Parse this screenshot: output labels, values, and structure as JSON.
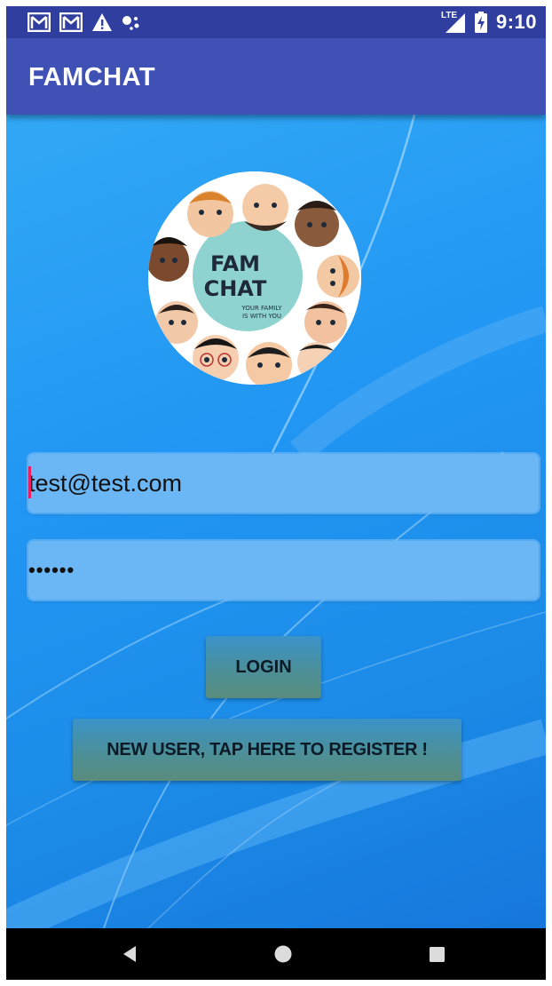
{
  "status_bar": {
    "time": "9:10",
    "network_label": "LTE",
    "left_icons": [
      "gmail-icon",
      "gmail-icon",
      "warning-icon",
      "assistant-dots-icon"
    ],
    "right_icons": [
      "signal-icon",
      "battery-charging-icon"
    ]
  },
  "app_bar": {
    "title": "FAMCHAT",
    "color": "#3f51b5"
  },
  "logo": {
    "line1": "FAM",
    "line2": "CHAT",
    "tagline1": "YOUR FAMILY",
    "tagline2": "IS WITH YOU"
  },
  "form": {
    "email_value": "test@test.com",
    "password_value": "••••••"
  },
  "buttons": {
    "login_label": "LOGIN",
    "register_label": "NEW USER, TAP HERE TO REGISTER !"
  },
  "nav_bar": {
    "icons": [
      "back-icon",
      "home-icon",
      "recents-icon"
    ]
  },
  "colors": {
    "status_bar": "#303f9f",
    "background": "#2196f3",
    "field": "#6bb7f6",
    "cursor": "#e91e63"
  }
}
